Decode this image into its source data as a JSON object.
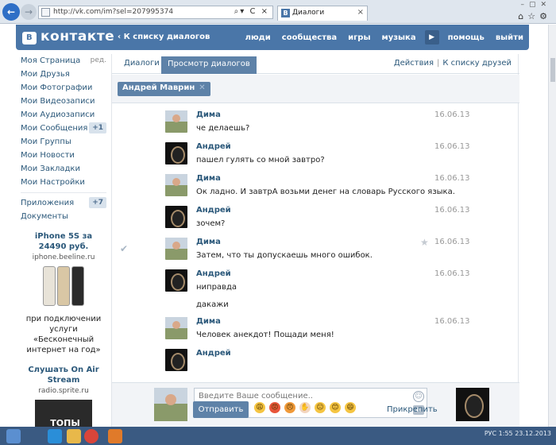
{
  "browser": {
    "url": "http://vk.com/im?sel=207995374",
    "tab_title": "Диалоги",
    "tab_favicon": "B"
  },
  "header": {
    "logo": "контакте",
    "logo_mark": "B",
    "back_link": "К списку диалогов",
    "menu": [
      "люди",
      "сообщества",
      "игры",
      "музыка",
      "помощь",
      "выйти"
    ]
  },
  "sidebar": {
    "items": [
      {
        "label": "Моя Страница",
        "meta": "ред."
      },
      {
        "label": "Мои Друзья"
      },
      {
        "label": "Мои Фотографии"
      },
      {
        "label": "Мои Видеозаписи"
      },
      {
        "label": "Мои Аудиозаписи"
      },
      {
        "label": "Мои Сообщения",
        "count": "+1"
      },
      {
        "label": "Мои Группы"
      },
      {
        "label": "Мои Новости"
      },
      {
        "label": "Мои Закладки"
      },
      {
        "label": "Мои Настройки"
      }
    ],
    "items2": [
      {
        "label": "Приложения",
        "count": "+7"
      },
      {
        "label": "Документы"
      }
    ],
    "ad1": {
      "title": "iPhone 5S за 24490 руб.",
      "domain": "iphone.beeline.ru",
      "text": "при подключении услуги «Бесконечный интернет на год»"
    },
    "ad2": {
      "title": "Слушать On Air Stream",
      "domain": "radio.sprite.ru",
      "image_text": "ТОПЫ ЧАРТОВ"
    }
  },
  "main": {
    "tabs": [
      "Диалоги",
      "Просмотр диалогов"
    ],
    "right_links": [
      "Действия",
      "К списку друзей"
    ],
    "filter_chip": "Андрей Маврин"
  },
  "messages": [
    {
      "author": "Дима",
      "date": "16.06.13",
      "lines": [
        "че делаешь?"
      ],
      "avatar": "dima"
    },
    {
      "author": "Андрей",
      "date": "16.06.13",
      "lines": [
        "пашел гулять со мной завтро?"
      ],
      "avatar": "andrey"
    },
    {
      "author": "Дима",
      "date": "16.06.13",
      "lines": [
        "Ок ладно. И завтрА возьми денег на словарь Русского языка."
      ],
      "avatar": "dima"
    },
    {
      "author": "Андрей",
      "date": "16.06.13",
      "lines": [
        "зочем?"
      ],
      "avatar": "andrey"
    },
    {
      "author": "Дима",
      "date": "16.06.13",
      "lines": [
        "Затем, что ты допускаешь много ошибок."
      ],
      "avatar": "dima",
      "checked": true,
      "starred": true
    },
    {
      "author": "Андрей",
      "date": "16.06.13",
      "lines": [
        "ниправда",
        "дакажи"
      ],
      "avatar": "andrey"
    },
    {
      "author": "Дима",
      "date": "16.06.13",
      "lines": [
        "Человек анекдот! Пощади меня!"
      ],
      "avatar": "dima"
    },
    {
      "author": "Андрей",
      "date": "",
      "lines": [],
      "avatar": "andrey"
    }
  ],
  "compose": {
    "placeholder": "Введите Ваше сообщение..",
    "send_label": "Отправить",
    "attach_label": "Прикрепить",
    "emojis": [
      "😩",
      "😡",
      "😠",
      "✋",
      "😐",
      "😊",
      "😄"
    ]
  },
  "taskbar": {
    "lang": "РУС",
    "time": "1:55",
    "date": "23.12.2013"
  },
  "colors": {
    "vk_blue": "#4a76a8",
    "link": "#2b587a",
    "button": "#5e82a8"
  }
}
